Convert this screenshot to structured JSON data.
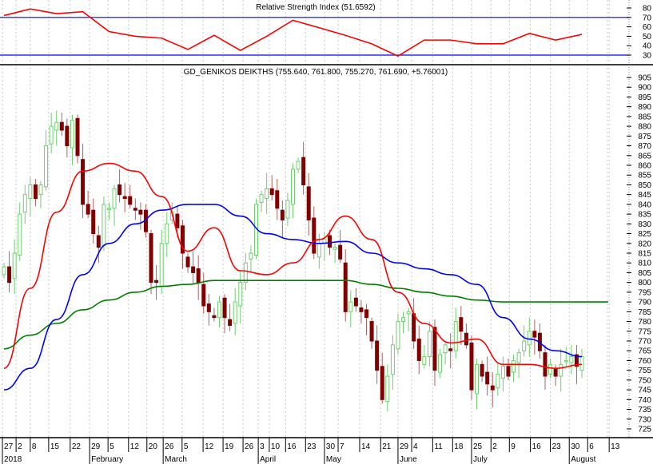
{
  "colors": {
    "rsi": "#ff0000",
    "rsi_bands": "#0000ff",
    "ma_short": "#ff0000",
    "ma_mid": "#0000ff",
    "ma_long": "#008000",
    "up": "#6fcf6f",
    "down": "#800000"
  },
  "chart_data": [
    {
      "type": "line",
      "title": "Relative Strength Index (51.6592)",
      "ylim": [
        20,
        85
      ],
      "yticks": [
        80,
        70,
        60,
        50,
        40,
        30
      ],
      "bands": [
        70,
        30
      ],
      "sample_every_sessions": 5,
      "values": [
        72,
        79,
        74,
        76,
        55,
        50,
        48,
        36,
        51,
        35,
        50,
        67,
        59,
        51,
        42,
        29,
        46,
        46,
        42,
        42,
        53,
        46,
        52
      ]
    },
    {
      "type": "candlestick",
      "title": "GD_GENIKOS DEIKTHS (755.640, 761.800, 755.270, 761.690, +5.76001)",
      "ylim": [
        722,
        908
      ],
      "yticks": [
        905,
        900,
        895,
        890,
        885,
        880,
        875,
        870,
        865,
        860,
        855,
        850,
        845,
        840,
        835,
        830,
        825,
        820,
        815,
        810,
        805,
        800,
        795,
        790,
        785,
        780,
        775,
        770,
        765,
        760,
        755,
        750,
        745,
        740,
        735,
        730,
        725
      ],
      "closes": [
        808,
        800,
        815,
        835,
        845,
        850,
        843,
        850,
        870,
        880,
        882,
        878,
        870,
        883,
        865,
        840,
        835,
        825,
        818,
        840,
        838,
        848,
        845,
        843,
        840,
        837,
        835,
        826,
        800,
        800,
        820,
        830,
        836,
        828,
        815,
        808,
        805,
        800,
        788,
        785,
        782,
        790,
        782,
        778,
        790,
        800,
        810,
        815,
        840,
        845,
        848,
        845,
        838,
        832,
        842,
        858,
        862,
        850,
        832,
        815,
        820,
        822,
        818,
        818,
        812,
        785,
        790,
        788,
        785,
        782,
        770,
        755,
        740,
        752,
        768,
        780,
        782,
        785,
        770,
        760,
        762,
        775,
        755,
        763,
        768,
        765,
        780,
        775,
        768,
        745,
        758,
        752,
        748,
        745,
        753,
        757,
        752,
        760,
        764,
        770,
        775,
        772,
        765,
        752,
        758,
        752,
        758,
        760,
        762,
        757,
        762
      ],
      "moving_averages": [
        {
          "name": "short",
          "color_key": "ma_short",
          "sample_every_sessions": 5,
          "values": [
            756,
            797,
            836,
            857,
            861,
            857,
            844,
            816,
            828,
            806,
            804,
            810,
            822,
            834,
            822,
            795,
            779,
            769,
            771,
            758,
            758,
            756,
            758
          ]
        },
        {
          "name": "mid",
          "color_key": "ma_mid",
          "sample_every_sessions": 5,
          "values": [
            745,
            756,
            781,
            804,
            820,
            830,
            837,
            840,
            840,
            834,
            825,
            822,
            820,
            821,
            815,
            810,
            807,
            804,
            799,
            782,
            771,
            765,
            762
          ]
        },
        {
          "name": "long",
          "color_key": "ma_long",
          "sample_every_sessions": 5,
          "values": [
            766,
            773,
            779,
            786,
            791,
            795,
            798,
            799,
            801,
            801,
            801,
            801,
            801,
            801,
            799,
            797,
            795,
            793,
            791,
            790,
            790,
            790,
            790,
            790
          ]
        }
      ]
    }
  ],
  "x_axis": {
    "day_ticks": [
      {
        "label": "27",
        "s": -0.3
      },
      {
        "label": "2",
        "s": 2.3
      },
      {
        "label": "8",
        "s": 5
      },
      {
        "label": "15",
        "s": 8.5
      },
      {
        "label": "22",
        "s": 12.6
      },
      {
        "label": "29",
        "s": 16.3
      },
      {
        "label": "5",
        "s": 19.8
      },
      {
        "label": "12",
        "s": 23.7
      },
      {
        "label": "20",
        "s": 27.2
      },
      {
        "label": "26",
        "s": 30.3
      },
      {
        "label": "5",
        "s": 33.9
      },
      {
        "label": "12",
        "s": 37.9
      },
      {
        "label": "19",
        "s": 41.7
      },
      {
        "label": "26",
        "s": 45.5
      },
      {
        "label": "3",
        "s": 48.4
      },
      {
        "label": "10",
        "s": 50.5
      },
      {
        "label": "16",
        "s": 53.6
      },
      {
        "label": "23",
        "s": 57.4
      },
      {
        "label": "30",
        "s": 61
      },
      {
        "label": "7",
        "s": 63.6
      },
      {
        "label": "14",
        "s": 67.7
      },
      {
        "label": "21",
        "s": 71.7
      },
      {
        "label": "29",
        "s": 75
      },
      {
        "label": "4",
        "s": 77.6
      },
      {
        "label": "11",
        "s": 81.6
      },
      {
        "label": "18",
        "s": 85.4
      },
      {
        "label": "25",
        "s": 89
      },
      {
        "label": "2",
        "s": 92.7
      },
      {
        "label": "9",
        "s": 96.2
      },
      {
        "label": "16",
        "s": 100.2
      },
      {
        "label": "23",
        "s": 104
      },
      {
        "label": "30",
        "s": 107.6
      },
      {
        "label": "6",
        "s": 111.1
      },
      {
        "label": "13",
        "s": 115.2
      }
    ],
    "month_ticks": [
      {
        "label": "2018",
        "s": -0.3
      },
      {
        "label": "February",
        "s": 16.3
      },
      {
        "label": "March",
        "s": 30.3
      },
      {
        "label": "April",
        "s": 48.4
      },
      {
        "label": "May",
        "s": 61
      },
      {
        "label": "June",
        "s": 75
      },
      {
        "label": "July",
        "s": 89
      },
      {
        "label": "August",
        "s": 107.6
      }
    ]
  }
}
